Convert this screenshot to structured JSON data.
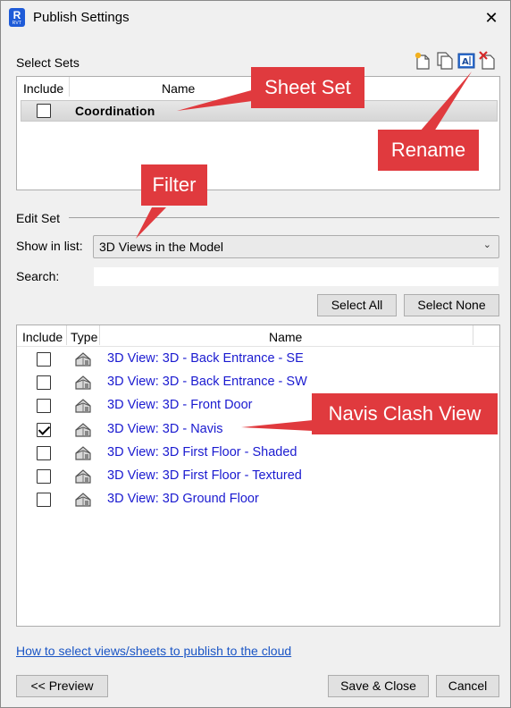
{
  "window": {
    "title": "Publish Settings",
    "app_icon_letter": "R",
    "app_icon_sub": "RVT",
    "close_glyph": "✕"
  },
  "select_sets": {
    "label": "Select Sets",
    "col_include": "Include",
    "col_name": "Name",
    "sets": [
      {
        "name": "Coordination",
        "checked": false
      }
    ],
    "toolbar_icons": [
      "new-set-icon",
      "duplicate-set-icon",
      "rename-set-icon",
      "delete-set-icon"
    ]
  },
  "edit_set": {
    "label": "Edit Set",
    "show_in_list_label": "Show in list:",
    "show_in_list_value": "3D Views in the Model",
    "search_label": "Search:",
    "search_value": "",
    "select_all": "Select All",
    "select_none": "Select None",
    "col_include": "Include",
    "col_type": "Type",
    "col_name": "Name",
    "views": [
      {
        "name": "3D View: 3D - Back Entrance - SE",
        "checked": false
      },
      {
        "name": "3D View: 3D - Back Entrance - SW",
        "checked": false
      },
      {
        "name": "3D View: 3D - Front Door",
        "checked": false
      },
      {
        "name": "3D View: 3D - Navis",
        "checked": true
      },
      {
        "name": "3D View: 3D First Floor - Shaded",
        "checked": false
      },
      {
        "name": "3D View: 3D First Floor - Textured",
        "checked": false
      },
      {
        "name": "3D View: 3D Ground Floor",
        "checked": false
      }
    ]
  },
  "help_link": "How to select views/sheets to publish to the cloud",
  "buttons": {
    "preview": "<< Preview",
    "save_close": "Save & Close",
    "cancel": "Cancel"
  },
  "callouts": {
    "sheet_set": "Sheet Set",
    "rename": "Rename",
    "filter": "Filter",
    "navis_clash_view": "Navis Clash View"
  },
  "colors": {
    "callout": "#e03a3e",
    "link": "#1a55c5",
    "view_name": "#1a1ad0"
  }
}
